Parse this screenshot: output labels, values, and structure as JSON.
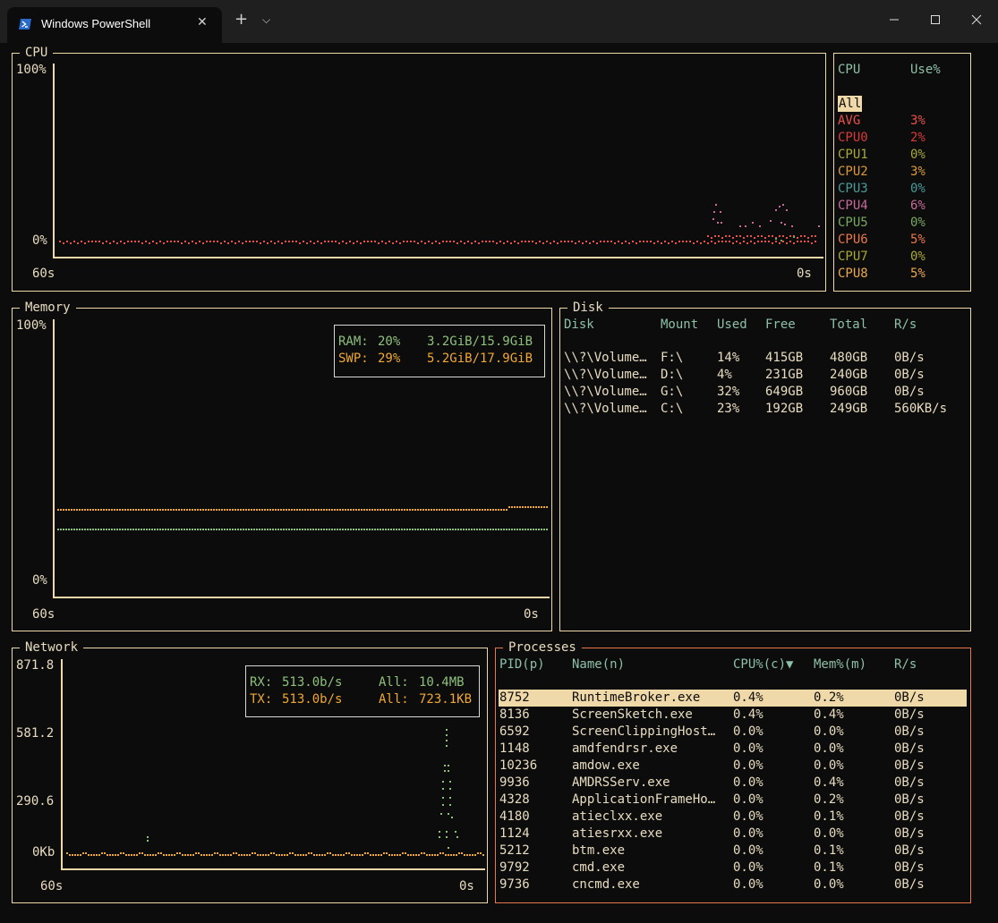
{
  "window": {
    "tab_title": "Windows PowerShell",
    "tab_icon": "powershell-icon",
    "colors": {
      "title_bar": "#1f1f1f",
      "background": "#0c0c0c",
      "border": "#f0d9a8",
      "processes_border": "#e8784a"
    }
  },
  "cpu": {
    "title": "CPU",
    "y_max_label": "100%",
    "y_min_label": "0%",
    "x_left_label": "60s",
    "x_right_label": "0s",
    "list_header": {
      "name": "CPU",
      "use": "Use%"
    },
    "all_label": "All",
    "items": [
      {
        "name": "AVG",
        "use": "3%",
        "color": "#e8504a"
      },
      {
        "name": "CPU0",
        "use": "2%",
        "color": "#d83a3a"
      },
      {
        "name": "CPU1",
        "use": "0%",
        "color": "#a8a838"
      },
      {
        "name": "CPU2",
        "use": "3%",
        "color": "#d89a3a"
      },
      {
        "name": "CPU3",
        "use": "0%",
        "color": "#4a9a98"
      },
      {
        "name": "CPU4",
        "use": "6%",
        "color": "#c86a98"
      },
      {
        "name": "CPU5",
        "use": "0%",
        "color": "#78a860"
      },
      {
        "name": "CPU6",
        "use": "5%",
        "color": "#e8784a"
      },
      {
        "name": "CPU7",
        "use": "0%",
        "color": "#a8a838"
      },
      {
        "name": "CPU8",
        "use": "5%",
        "color": "#e8a850"
      }
    ]
  },
  "memory": {
    "title": "Memory",
    "y_max_label": "100%",
    "y_min_label": "0%",
    "x_left_label": "60s",
    "x_right_label": "0s",
    "ram": {
      "label": "RAM:",
      "percent": "20%",
      "usage": "3.2GiB/15.9GiB",
      "color": "#8ec07c"
    },
    "swap": {
      "label": "SWP:",
      "percent": "29%",
      "usage": "5.2GiB/17.9GiB",
      "color": "#f0a830"
    }
  },
  "disk": {
    "title": "Disk",
    "headers": [
      "Disk",
      "Mount",
      "Used",
      "Free",
      "Total",
      "R/s"
    ],
    "rows": [
      [
        "\\\\?\\Volume…",
        "F:\\",
        "14%",
        "415GB",
        "480GB",
        "0B/s"
      ],
      [
        "\\\\?\\Volume…",
        "D:\\",
        "4%",
        "231GB",
        "240GB",
        "0B/s"
      ],
      [
        "\\\\?\\Volume…",
        "G:\\",
        "32%",
        "649GB",
        "960GB",
        "0B/s"
      ],
      [
        "\\\\?\\Volume…",
        "C:\\",
        "23%",
        "192GB",
        "249GB",
        "560KB/s"
      ]
    ]
  },
  "network": {
    "title": "Network",
    "y_labels": [
      "871.8",
      "581.2",
      "290.6",
      "0Kb"
    ],
    "x_left_label": "60s",
    "x_right_label": "0s",
    "rx": {
      "label": "RX:",
      "rate": "513.0b/s",
      "all_label": "All:",
      "all": "10.4MB",
      "color": "#8ec07c"
    },
    "tx": {
      "label": "TX:",
      "rate": "513.0b/s",
      "all_label": "All:",
      "all": "723.1KB",
      "color": "#f0a830"
    }
  },
  "processes": {
    "title": "Processes",
    "headers": [
      "PID(p)",
      "Name(n)",
      "CPU%(c)▼",
      "Mem%(m)",
      "R/s"
    ],
    "rows": [
      [
        "8752",
        "RuntimeBroker.exe",
        "0.4%",
        "0.2%",
        "0B/s"
      ],
      [
        "8136",
        "ScreenSketch.exe",
        "0.4%",
        "0.4%",
        "0B/s"
      ],
      [
        "6592",
        "ScreenClippingHost…",
        "0.0%",
        "0.0%",
        "0B/s"
      ],
      [
        "1148",
        "amdfendrsr.exe",
        "0.0%",
        "0.0%",
        "0B/s"
      ],
      [
        "10236",
        "amdow.exe",
        "0.0%",
        "0.0%",
        "0B/s"
      ],
      [
        "9936",
        "AMDRSServ.exe",
        "0.0%",
        "0.4%",
        "0B/s"
      ],
      [
        "4328",
        "ApplicationFrameHo…",
        "0.0%",
        "0.2%",
        "0B/s"
      ],
      [
        "4180",
        "atieclxx.exe",
        "0.0%",
        "0.1%",
        "0B/s"
      ],
      [
        "1124",
        "atiesrxx.exe",
        "0.0%",
        "0.0%",
        "0B/s"
      ],
      [
        "5212",
        "btm.exe",
        "0.0%",
        "0.1%",
        "0B/s"
      ],
      [
        "9792",
        "cmd.exe",
        "0.0%",
        "0.1%",
        "0B/s"
      ],
      [
        "9736",
        "cncmd.exe",
        "0.0%",
        "0.0%",
        "0B/s"
      ]
    ]
  }
}
